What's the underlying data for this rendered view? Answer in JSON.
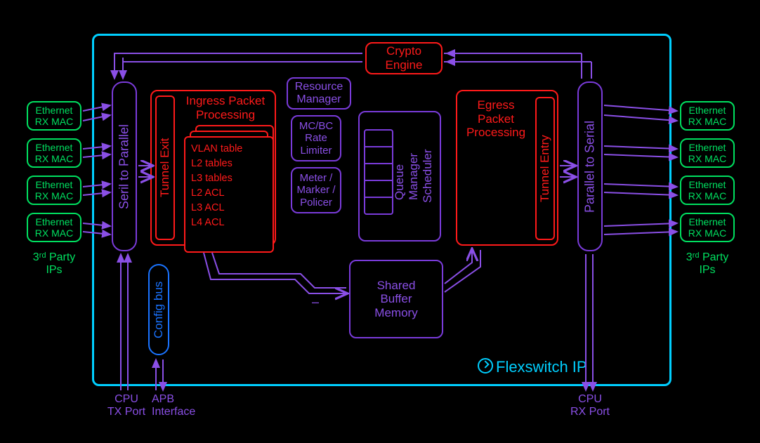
{
  "outer_label": "Flexswitch IP",
  "left_macs": [
    {
      "l1": "Ethernet",
      "l2": "RX MAC"
    },
    {
      "l1": "Ethernet",
      "l2": "RX MAC"
    },
    {
      "l1": "Ethernet",
      "l2": "RX MAC"
    },
    {
      "l1": "Ethernet",
      "l2": "RX MAC"
    }
  ],
  "right_macs": [
    {
      "l1": "Ethernet",
      "l2": "RX MAC"
    },
    {
      "l1": "Ethernet",
      "l2": "RX MAC"
    },
    {
      "l1": "Ethernet",
      "l2": "RX MAC"
    },
    {
      "l1": "Ethernet",
      "l2": "RX MAC"
    }
  ],
  "third_party_left": "3ʳᵈ Party\nIPs",
  "third_party_right": "3ʳᵈ Party\nIPs",
  "serial_to_parallel": "Seril to Parallel",
  "parallel_to_serial": "Parallel to Serial",
  "tunnel_exit": "Tunnel Exit",
  "tunnel_entry": "Tunnel Entry",
  "ingress_title": "Ingress Packet\nProcessing",
  "ingress_tables": [
    "VLAN table",
    "L2 tables",
    "L3 tables",
    "L2 ACL",
    "L3 ACL",
    "L4 ACL"
  ],
  "resource_manager": "Resource\nManager",
  "mc_bc": "MC/BC\nRate\nLimiter",
  "meter": "Meter /\nMarker /\nPolicer",
  "queue_manager": "Queue\nManager",
  "scheduler": "Scheduler",
  "egress_title": "Egress\nPacket\nProcessing",
  "shared_buffer": "Shared\nBuffer\nMemory",
  "crypto": "Crypto\nEngine",
  "config_bus": "Config bus",
  "cpu_tx": "CPU\nTX Port",
  "apb": "APB\nInterface",
  "cpu_rx": "CPU\nRX Port"
}
